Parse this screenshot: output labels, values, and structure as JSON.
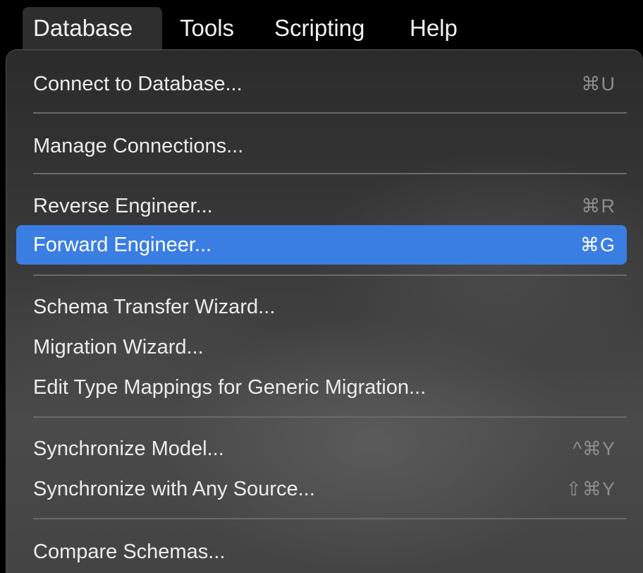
{
  "menubar": {
    "items": [
      {
        "label": "Database",
        "active": true
      },
      {
        "label": "Tools",
        "active": false
      },
      {
        "label": "Scripting",
        "active": false
      },
      {
        "label": "Help",
        "active": false
      }
    ]
  },
  "menu": {
    "items": [
      {
        "label": "Connect to Database...",
        "shortcut": "⌘U"
      },
      {
        "label": "Manage Connections...",
        "shortcut": ""
      },
      {
        "label": "Reverse Engineer...",
        "shortcut": "⌘R"
      },
      {
        "label": "Forward Engineer...",
        "shortcut": "⌘G",
        "highlighted": true
      },
      {
        "label": "Schema Transfer Wizard...",
        "shortcut": ""
      },
      {
        "label": "Migration Wizard...",
        "shortcut": ""
      },
      {
        "label": "Edit Type Mappings for Generic Migration...",
        "shortcut": ""
      },
      {
        "label": "Synchronize Model...",
        "shortcut": "^⌘Y"
      },
      {
        "label": "Synchronize with Any Source...",
        "shortcut": "⇧⌘Y"
      },
      {
        "label": "Compare Schemas...",
        "shortcut": ""
      }
    ]
  },
  "colors": {
    "highlight": "#3a7ee4",
    "menu_text": "#ececec",
    "shortcut_text": "#8d8d8d",
    "menubar_bg": "#000000"
  }
}
